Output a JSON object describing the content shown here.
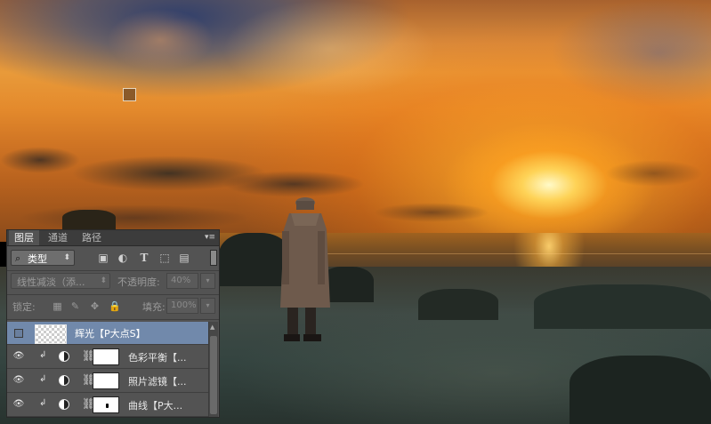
{
  "panel": {
    "tabs": [
      {
        "label": "图层",
        "active": true
      },
      {
        "label": "通道",
        "active": false
      },
      {
        "label": "路径",
        "active": false
      }
    ],
    "menu_icon": "panel-menu-icon",
    "filter": {
      "kind_label": "类型",
      "icons": [
        "image-filter-icon",
        "adjustment-filter-icon",
        "type-filter-icon",
        "shape-filter-icon",
        "smart-object-filter-icon"
      ]
    },
    "blend_mode": "线性减淡（添...",
    "opacity_label": "不透明度:",
    "opacity_value": "40%",
    "lock_label": "锁定:",
    "fill_label": "填充:",
    "fill_value": "100%",
    "layers": [
      {
        "name": "辉光【P大点S】",
        "visible": false,
        "selected": true,
        "type": "pixel"
      },
      {
        "name": "色彩平衡【...",
        "visible": true,
        "selected": false,
        "type": "adjustment"
      },
      {
        "name": "照片滤镜【...",
        "visible": true,
        "selected": false,
        "type": "adjustment"
      },
      {
        "name": "曲线【P大...",
        "visible": true,
        "selected": false,
        "type": "adjustment"
      }
    ],
    "selected_color": "#7189ab"
  },
  "canvas": {
    "marker_color": "#8a5a2a"
  }
}
